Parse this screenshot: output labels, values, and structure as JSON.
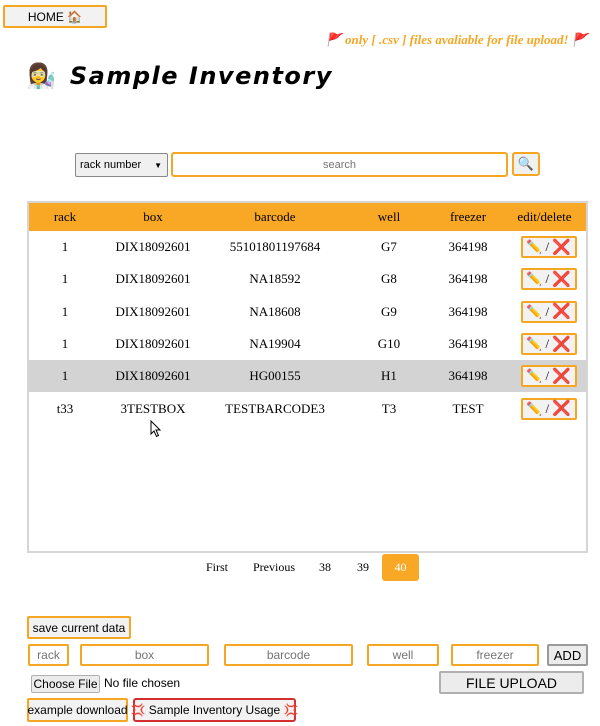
{
  "nav": {
    "home_label": "HOME 🏠"
  },
  "notice": "🚩 only [ .csv ] files avaliable for file upload! 🚩",
  "header": {
    "title": "Sample Inventory",
    "title_emoji": "👩‍🔬"
  },
  "search": {
    "filter_selected": "rack number",
    "placeholder": "search",
    "button_icon": "🔍"
  },
  "table": {
    "columns": [
      "rack",
      "box",
      "barcode",
      "well",
      "freezer",
      "edit/delete"
    ],
    "rows": [
      {
        "rack": "1",
        "box": "DIX18092601",
        "barcode": "55101801197684",
        "well": "G7",
        "freezer": "364198",
        "selected": false
      },
      {
        "rack": "1",
        "box": "DIX18092601",
        "barcode": "NA18592",
        "well": "G8",
        "freezer": "364198",
        "selected": false
      },
      {
        "rack": "1",
        "box": "DIX18092601",
        "barcode": "NA18608",
        "well": "G9",
        "freezer": "364198",
        "selected": false
      },
      {
        "rack": "1",
        "box": "DIX18092601",
        "barcode": "NA19904",
        "well": "G10",
        "freezer": "364198",
        "selected": false
      },
      {
        "rack": "1",
        "box": "DIX18092601",
        "barcode": "HG00155",
        "well": "H1",
        "freezer": "364198",
        "selected": true
      },
      {
        "rack": "t33",
        "box": "3TESTBOX",
        "barcode": "TESTBARCODE3",
        "well": "T3",
        "freezer": "TEST",
        "selected": false
      }
    ],
    "edit_icon": "✏️",
    "edit_separator": "/",
    "delete_icon": "❌"
  },
  "pagination": {
    "first": "First",
    "previous": "Previous",
    "pages": [
      "38",
      "39",
      "40"
    ],
    "active_page": "40"
  },
  "actions": {
    "save_label": "save current data",
    "add_label": "ADD",
    "file_button": "Choose File",
    "file_status": "No file chosen",
    "upload_label": "FILE UPLOAD",
    "example_label": "example download",
    "usage_label": "💢 Sample Inventory Usage 💢"
  },
  "add_form": {
    "rack_placeholder": "rack",
    "box_placeholder": "box",
    "barcode_placeholder": "barcode",
    "well_placeholder": "well",
    "freezer_placeholder": "freezer"
  },
  "colors": {
    "accent": "#f9a825",
    "border_accent": "#f5a623",
    "danger": "#d32f2f",
    "selected_row": "#d3d3d3"
  }
}
